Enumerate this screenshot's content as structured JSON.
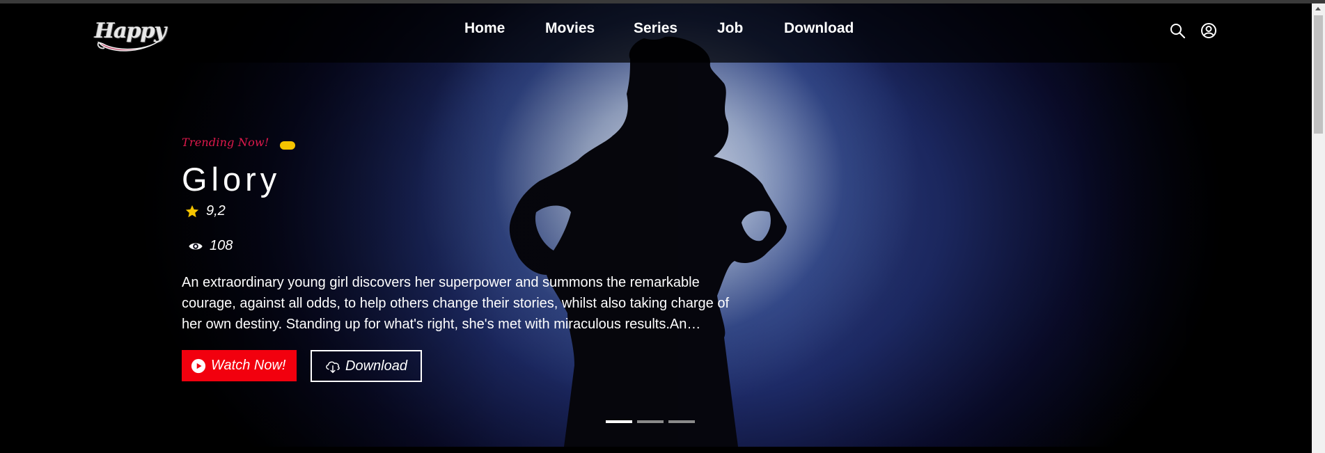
{
  "brand": {
    "logo_text": "Happy"
  },
  "nav": {
    "items": [
      {
        "label": "Home"
      },
      {
        "label": "Movies"
      },
      {
        "label": "Series"
      },
      {
        "label": "Job"
      },
      {
        "label": "Download"
      }
    ],
    "icons": [
      "search-icon",
      "user-account-icon"
    ]
  },
  "hero": {
    "tagline": "Trending Now!",
    "title": "Glory",
    "rating": "9,2",
    "views": "108",
    "description": "An extraordinary young girl discovers her superpower and summons the remarkable courage, against all odds, to help others change their stories, whilst also taking charge of her own destiny. Standing up for what's right, she's met with miraculous results.An…",
    "watch_label": "Watch Now!",
    "download_label": "Download",
    "slides_total": 3,
    "active_slide": 1
  },
  "colors": {
    "accent_red": "#f2000e",
    "tagline_pink": "#e0194c",
    "rating_star": "#f5c400",
    "badge_yellow": "#f5c400"
  }
}
